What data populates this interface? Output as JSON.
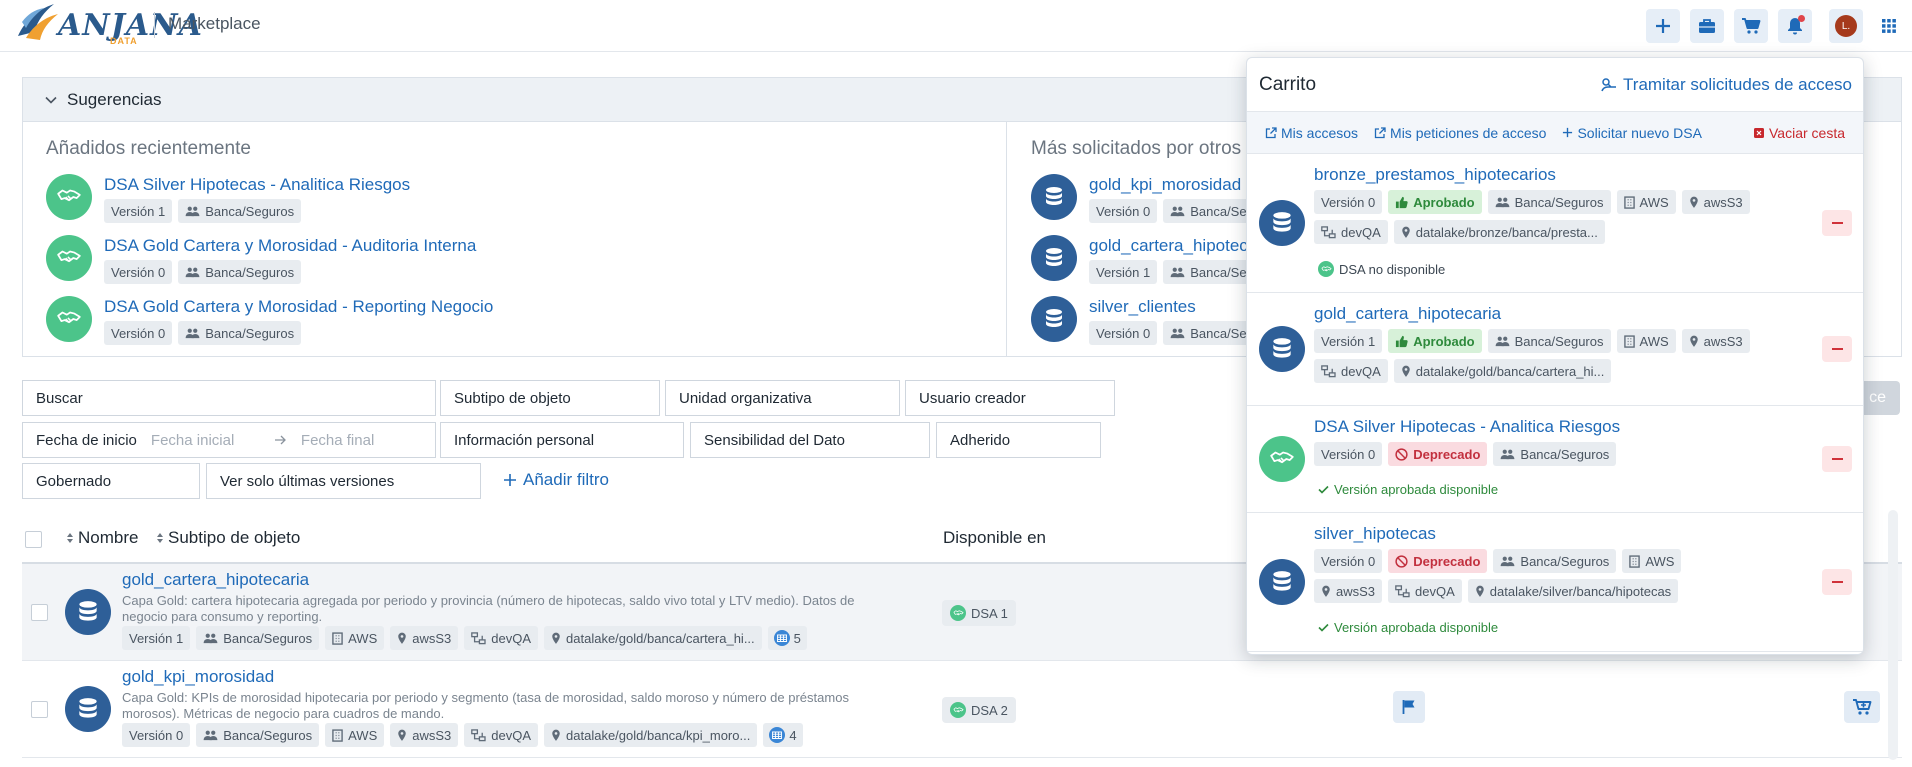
{
  "header": {
    "logo_text": "ANJANA",
    "logo_sub": "DATA",
    "app_title": "Marketplace",
    "avatar_initial": "L.",
    "icons": [
      "plus-icon",
      "briefcase-icon",
      "cart-icon",
      "bell-icon",
      "avatar",
      "grid-icon"
    ]
  },
  "suggestions": {
    "title": "Sugerencias",
    "recent": {
      "title": "Añadidos recientemente",
      "items": [
        {
          "name": "DSA Silver Hipotecas - Analitica Riesgos",
          "version": "Versión 1",
          "org": "Banca/Seguros"
        },
        {
          "name": "DSA Gold Cartera y Morosidad - Auditoria Interna",
          "version": "Versión 0",
          "org": "Banca/Seguros"
        },
        {
          "name": "DSA Gold Cartera y Morosidad - Reporting Negocio",
          "version": "Versión 0",
          "org": "Banca/Seguros"
        }
      ]
    },
    "popular": {
      "title": "Más solicitados por otros",
      "items": [
        {
          "name": "gold_kpi_morosidad",
          "version": "Versión 0",
          "org": "Banca/Seg"
        },
        {
          "name": "gold_cartera_hipoteca",
          "version": "Versión 1",
          "org": "Banca/Seg"
        },
        {
          "name": "silver_clientes",
          "version": "Versión 0",
          "org": "Banca/Seg"
        }
      ]
    }
  },
  "filters": {
    "buscar": "Buscar",
    "subtipo": "Subtipo de objeto",
    "unidad": "Unidad organizativa",
    "usuario": "Usuario creador",
    "fecha_inicio": "Fecha de inicio",
    "fecha_inicial_ph": "Fecha inicial",
    "fecha_final_ph": "Fecha final",
    "info_personal": "Información personal",
    "sensibilidad": "Sensibilidad del Dato",
    "adherido": "Adherido",
    "gobernado": "Gobernado",
    "ultimas": "Ver solo últimas versiones",
    "add_filter": "Añadir filtro",
    "ghost_button": "ce"
  },
  "table": {
    "headers": {
      "nombre": "Nombre",
      "subtipo": "Subtipo de objeto",
      "disponible": "Disponible en"
    },
    "rows": [
      {
        "name": "gold_cartera_hipotecaria",
        "desc": "Capa Gold: cartera hipotecaria agregada por periodo y provincia (número de hipotecas, saldo vivo total y LTV medio). Datos de negocio para consumo y reporting.",
        "version": "Versión 1",
        "org": "Banca/Seguros",
        "cloud": "AWS",
        "storage": "awsS3",
        "env": "devQA",
        "path": "datalake/gold/banca/cartera_hi...",
        "tables": "5",
        "dsa": "DSA 1"
      },
      {
        "name": "gold_kpi_morosidad",
        "desc": "Capa Gold: KPIs de morosidad hipotecaria por periodo y segmento (tasa de morosidad, saldo moroso y número de préstamos morosos). Métricas de negocio para cuadros de mando.",
        "version": "Versión 0",
        "org": "Banca/Seguros",
        "cloud": "AWS",
        "storage": "awsS3",
        "env": "devQA",
        "path": "datalake/gold/banca/kpi_moro...",
        "tables": "4",
        "dsa": "DSA 2"
      }
    ]
  },
  "cart": {
    "title": "Carrito",
    "action": "Tramitar solicitudes de acceso",
    "links": {
      "accesos": "Mis accesos",
      "peticiones": "Mis peticiones de acceso",
      "nuevo_dsa": "Solicitar nuevo DSA",
      "vaciar": "Vaciar cesta"
    },
    "items": [
      {
        "name": "bronze_prestamos_hipotecarios",
        "version": "Versión 0",
        "status": "Aprobado",
        "org": "Banca/Seguros",
        "cloud": "AWS",
        "storage": "awsS3",
        "env": "devQA",
        "path": "datalake/bronze/banca/presta...",
        "note": "DSA no disponible"
      },
      {
        "name": "gold_cartera_hipotecaria",
        "version": "Versión 1",
        "status": "Aprobado",
        "org": "Banca/Seguros",
        "cloud": "AWS",
        "storage": "awsS3",
        "env": "devQA",
        "path": "datalake/gold/banca/cartera_hi..."
      },
      {
        "name": "DSA Silver Hipotecas - Analitica Riesgos",
        "version": "Versión 0",
        "status": "Deprecado",
        "org": "Banca/Seguros",
        "note": "Versión aprobada disponible"
      },
      {
        "name": "silver_hipotecas",
        "version": "Versión 0",
        "status": "Deprecado",
        "org": "Banca/Seguros",
        "cloud": "AWS",
        "storage": "awsS3",
        "env": "devQA",
        "path": "datalake/silver/banca/hipotecas",
        "note": "Versión aprobada disponible"
      }
    ]
  },
  "colors": {
    "brand": "#1f6ab8",
    "dataset_icon": "#2e5f98",
    "dsa_icon": "#4cc48a",
    "approved": "#2e8a3c",
    "deprecated": "#c2303e"
  }
}
